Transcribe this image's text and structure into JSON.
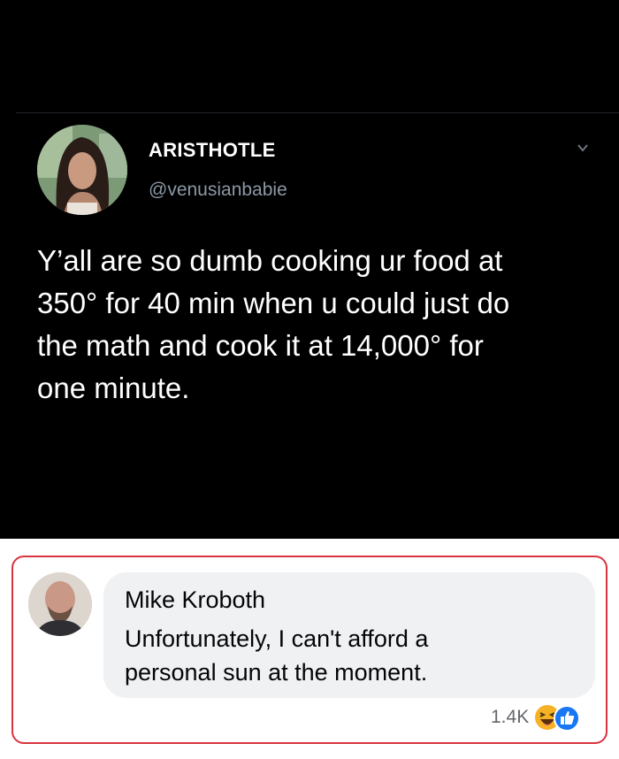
{
  "tweet": {
    "display_name": "ARISTHOTLE",
    "handle": "@venusianbabie",
    "text_lines": [
      "Y’all are so dumb cooking ur food at",
      "350° for 40 min when u could just do",
      "the math and cook it at 14,000° for",
      "one minute."
    ],
    "menu_icon": "chevron-down-icon",
    "colors": {
      "background": "#000000",
      "text": "#ffffff",
      "handle": "#8b98a5"
    }
  },
  "comment": {
    "author": "Mike Kroboth",
    "text_lines": [
      "Unfortunately, I can't afford a",
      "personal sun at the moment."
    ],
    "reaction_count": "1.4K",
    "reaction_icons": [
      "haha-icon",
      "like-icon"
    ],
    "colors": {
      "bubble": "#eff1f3",
      "highlight_border": "#d9343f",
      "like": "#1877f2",
      "haha": "#f7b125"
    }
  }
}
